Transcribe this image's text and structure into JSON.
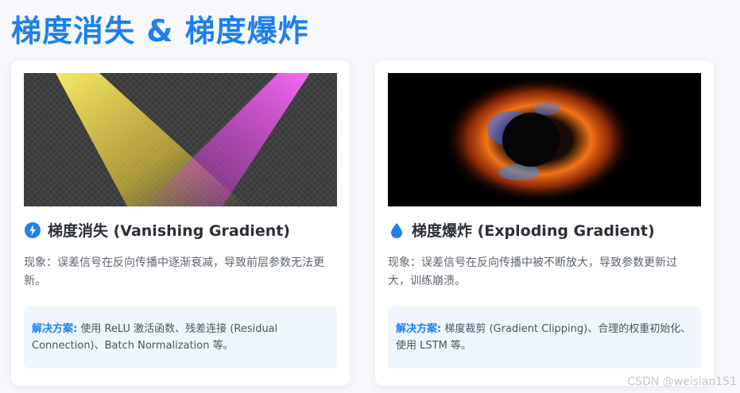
{
  "page": {
    "title": "梯度消失 & 梯度爆炸"
  },
  "cards": [
    {
      "heading": "梯度消失 (Vanishing Gradient)",
      "icon": "lightning-icon",
      "description": "现象：误差信号在反向传播中逐渐衰减，导致前层参数无法更新。",
      "solution_label": "解决方案:",
      "solution_text": " 使用 ReLU 激活函数、残差连接 (Residual Connection)、Batch Normalization 等。"
    },
    {
      "heading": "梯度爆炸 (Exploding Gradient)",
      "icon": "droplet-icon",
      "description": "现象：误差信号在反向传播中被不断放大，导致参数更新过大，训练崩溃。",
      "solution_label": "解决方案:",
      "solution_text": " 梯度裁剪 (Gradient Clipping)、合理的权重初始化、使用 LSTM 等。"
    }
  ],
  "watermark": "CSDN @weisian151",
  "colors": {
    "accent": "#1e7ff0",
    "card_bg": "#ffffff",
    "solution_bg": "#eef5fe"
  }
}
